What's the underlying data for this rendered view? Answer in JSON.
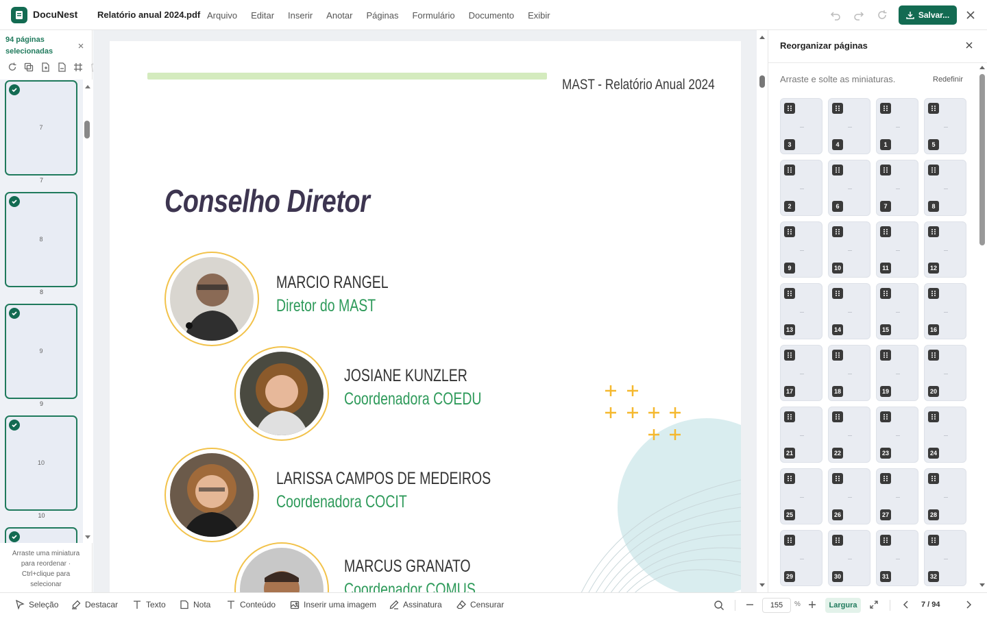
{
  "app": {
    "name": "DocuNest",
    "filename": "Relatório anual 2024.pdf"
  },
  "menu": [
    "Arquivo",
    "Editar",
    "Inserir",
    "Anotar",
    "Páginas",
    "Formulário",
    "Documento",
    "Exibir"
  ],
  "toolbar": {
    "save_label": "Salvar..."
  },
  "sidebar": {
    "selection": "94 páginas selecionadas",
    "thumbnails": [
      {
        "page": "7",
        "label": "7"
      },
      {
        "page": "8",
        "label": "8"
      },
      {
        "page": "9",
        "label": "9"
      },
      {
        "page": "10",
        "label": "10"
      }
    ],
    "hint": "Arraste uma miniatura para reordenar · Ctrl+clique para selecionar"
  },
  "document": {
    "header": "MAST - Relatório Anual 2024",
    "title": "Conselho Diretor",
    "people": [
      {
        "name": "MARCIO RANGEL",
        "role": "Diretor do MAST"
      },
      {
        "name": "JOSIANE KUNZLER",
        "role": "Coordenadora COEDU"
      },
      {
        "name": "LARISSA CAMPOS DE MEDEIROS",
        "role": "Coordenadora COCIT"
      },
      {
        "name": "MARCUS GRANATO",
        "role": "Coordenador COMUS"
      }
    ]
  },
  "reorder_panel": {
    "title": "Reorganizar páginas",
    "hint": "Arraste e solte as miniaturas.",
    "reset_label": "Redefinir",
    "order": [
      "3",
      "4",
      "1",
      "5",
      "2",
      "6",
      "7",
      "8",
      "9",
      "10",
      "11",
      "12",
      "13",
      "14",
      "15",
      "16",
      "17",
      "18",
      "19",
      "20",
      "21",
      "22",
      "23",
      "24",
      "25",
      "26",
      "27",
      "28",
      "29",
      "30",
      "31",
      "32"
    ]
  },
  "bottom_tools": [
    "Seleção",
    "Destacar",
    "Texto",
    "Nota",
    "Conteúdo",
    "Inserir uma imagem",
    "Assinatura",
    "Censurar"
  ],
  "zoom": {
    "value": "155",
    "unit": "%",
    "fit_label": "Largura"
  },
  "pagination": {
    "indicator": "7 / 94"
  },
  "colors": {
    "brand": "#136b52",
    "accent_green": "#2e9a5a",
    "ring": "#f2c24a",
    "plus": "#f5b82e"
  }
}
